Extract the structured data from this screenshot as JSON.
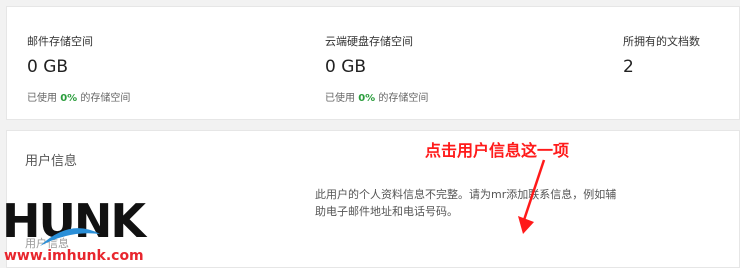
{
  "storage_stats": {
    "mail": {
      "label": "邮件存储空间",
      "value": "0 GB",
      "used_prefix": "已使用",
      "used_percent": "0%",
      "used_suffix": "的存储空间"
    },
    "cloud": {
      "label": "云端硬盘存储空间",
      "value": "0 GB",
      "used_prefix": "已使用",
      "used_percent": "0%",
      "used_suffix": "的存储空间"
    },
    "docs": {
      "label": "所拥有的文档数",
      "value": "2"
    }
  },
  "user_info": {
    "title": "用户信息",
    "message": "此用户的个人资料信息不完整。请为mr添加联系信息，例如辅助电子邮件地址和电话号码。",
    "faded_label": "用户信息"
  },
  "annotation": {
    "text": "点击用户信息这一项",
    "color": "#ff1a1a"
  },
  "watermark": {
    "logo": "HUNK",
    "url": "www.imhunk.com"
  },
  "colors": {
    "percent_green": "#2a9d3c",
    "background": "#f2f2f2",
    "card": "#ffffff"
  }
}
